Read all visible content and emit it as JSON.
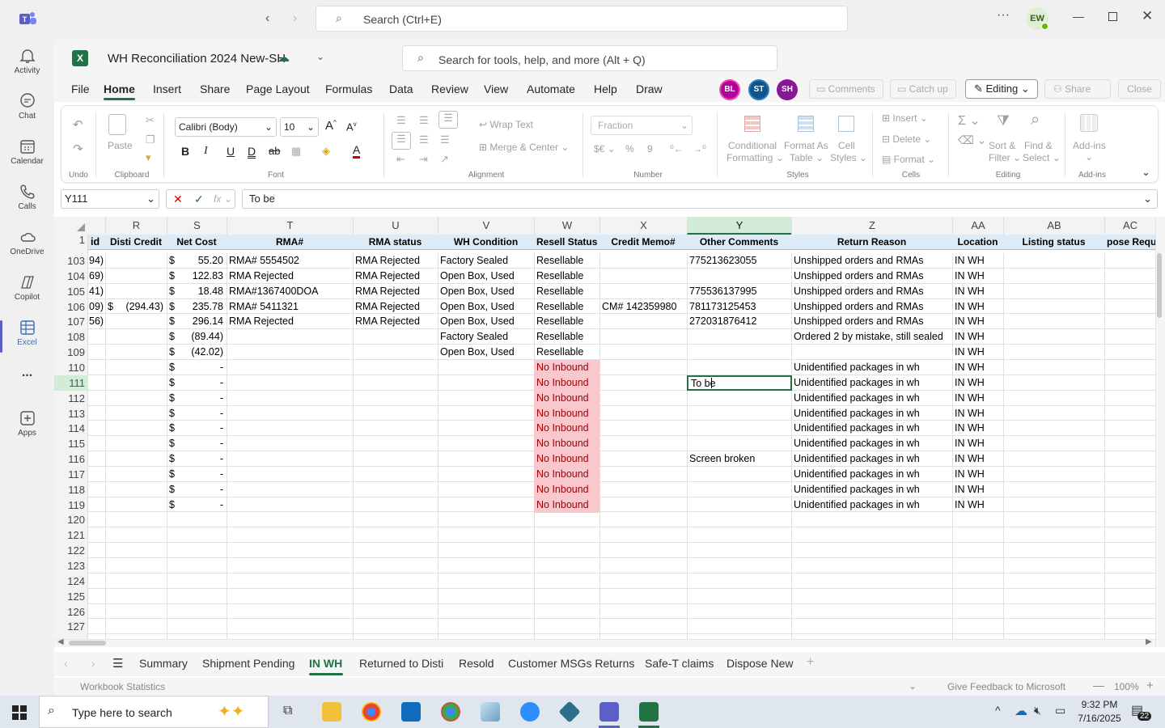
{
  "teams": {
    "search_placeholder": "Search (Ctrl+E)",
    "user_initials": "EW"
  },
  "rail": [
    {
      "label": "Activity",
      "icon": "bell-icon"
    },
    {
      "label": "Chat",
      "icon": "chat-icon"
    },
    {
      "label": "Calendar",
      "icon": "calendar-icon"
    },
    {
      "label": "Calls",
      "icon": "phone-icon"
    },
    {
      "label": "OneDrive",
      "icon": "cloud-icon"
    },
    {
      "label": "Copilot",
      "icon": "copilot-icon"
    },
    {
      "label": "Excel",
      "icon": "excel-icon"
    },
    {
      "label": "...",
      "icon": "more-icon"
    },
    {
      "label": "Apps",
      "icon": "apps-icon"
    }
  ],
  "workbook": {
    "title": "WH Reconciliation 2024 New-SH",
    "tools_search": "Search for tools, help, and more (Alt + Q)"
  },
  "menu": [
    "File",
    "Home",
    "Insert",
    "Share",
    "Page Layout",
    "Formulas",
    "Data",
    "Review",
    "View",
    "Automate",
    "Help",
    "Draw"
  ],
  "collab": {
    "avatars": [
      {
        "initials": "BL",
        "color": "#b4009e"
      },
      {
        "initials": "ST",
        "color": "#0f548c"
      },
      {
        "initials": "SH",
        "color": "#881798"
      }
    ],
    "comments": "Comments",
    "catchup": "Catch up",
    "editing": "Editing",
    "share": "Share",
    "close": "Close"
  },
  "ribbon": {
    "undo": "Undo",
    "paste": "Paste",
    "clipboard": "Clipboard",
    "font_name": "Calibri (Body)",
    "font_size": "10",
    "font": "Font",
    "wrap_text": "Wrap Text",
    "merge_center": "Merge & Center",
    "alignment": "Alignment",
    "number_format": "Fraction",
    "number": "Number",
    "conditional": "Conditional",
    "formatting": "Formatting",
    "format_as": "Format As",
    "table": "Table",
    "cell": "Cell",
    "styles_btn": "Styles",
    "styles": "Styles",
    "insert": "Insert",
    "delete": "Delete",
    "format": "Format",
    "cells": "Cells",
    "sort": "Sort &",
    "filter": "Filter",
    "find": "Find &",
    "select": "Select",
    "editing": "Editing",
    "addins": "Add-ins",
    "addins_label": "Add-ins"
  },
  "formula": {
    "namebox": "Y111",
    "value": "To be"
  },
  "columns": [
    {
      "letter": "R",
      "header": "Disti Credit"
    },
    {
      "letter": "S",
      "header": "Net Cost"
    },
    {
      "letter": "T",
      "header": "RMA#"
    },
    {
      "letter": "U",
      "header": "RMA status"
    },
    {
      "letter": "V",
      "header": "WH Condition"
    },
    {
      "letter": "W",
      "header": "Resell Status"
    },
    {
      "letter": "X",
      "header": "Credit Memo#"
    },
    {
      "letter": "Y",
      "header": "Other Comments"
    },
    {
      "letter": "Z",
      "header": "Return Reason"
    },
    {
      "letter": "AA",
      "header": "Location"
    },
    {
      "letter": "AB",
      "header": "Listing status"
    },
    {
      "letter": "AC",
      "header": "pose Requir"
    }
  ],
  "partial_col_header": "id",
  "header_row_num": "1",
  "rows": [
    {
      "n": "103",
      "q": "94)",
      "r": "",
      "s": "55.20",
      "t": "RMA# 5554502",
      "u": "RMA Rejected",
      "v": "Factory Sealed",
      "w": "Resellable",
      "x": "",
      "y": "775213623055",
      "z": "Unshipped orders and RMAs",
      "aa": "IN WH"
    },
    {
      "n": "104",
      "q": "69)",
      "r": "",
      "s": "122.83",
      "t": "RMA Rejected",
      "u": "RMA Rejected",
      "v": "Open Box, Used",
      "w": "Resellable",
      "x": "",
      "y": "",
      "z": "Unshipped orders and RMAs",
      "aa": "IN WH"
    },
    {
      "n": "105",
      "q": "41)",
      "r": "",
      "s": "18.48",
      "t": "RMA#1367400DOA",
      "u": "RMA Rejected",
      "v": "Open Box, Used",
      "w": "Resellable",
      "x": "",
      "y": "775536137995",
      "z": "Unshipped orders and RMAs",
      "aa": "IN WH"
    },
    {
      "n": "106",
      "q": "09)",
      "r": "(294.43)",
      "s": "235.78",
      "t": "RMA# 5411321",
      "u": "RMA Rejected",
      "v": "Open Box, Used",
      "w": "Resellable",
      "x": "CM# 142359980",
      "y": "781173125453",
      "z": "Unshipped orders and RMAs",
      "aa": "IN WH"
    },
    {
      "n": "107",
      "q": "56)",
      "r": "",
      "s": "296.14",
      "t": "RMA Rejected",
      "u": "RMA Rejected",
      "v": "Open Box, Used",
      "w": "Resellable",
      "x": "",
      "y": "272031876412",
      "z": "Unshipped orders and RMAs",
      "aa": "IN WH"
    },
    {
      "n": "108",
      "q": "",
      "r": "",
      "s": "(89.44)",
      "t": "",
      "u": "",
      "v": "Factory Sealed",
      "w": "Resellable",
      "x": "",
      "y": "",
      "z": "Ordered 2 by mistake, still sealed",
      "aa": "IN WH"
    },
    {
      "n": "109",
      "q": "",
      "r": "",
      "s": "(42.02)",
      "t": "",
      "u": "",
      "v": "Open Box, Used",
      "w": "Resellable",
      "x": "",
      "y": "",
      "z": "",
      "aa": "IN WH"
    },
    {
      "n": "110",
      "q": "",
      "r": "",
      "s": "-",
      "t": "",
      "u": "",
      "v": "",
      "w": "No Inbound",
      "x": "",
      "y": "",
      "z": "Unidentified packages in wh",
      "aa": "IN WH"
    },
    {
      "n": "111",
      "q": "",
      "r": "",
      "s": "-",
      "t": "",
      "u": "",
      "v": "",
      "w": "No Inbound",
      "x": "",
      "y": "To be",
      "z": "Unidentified packages in wh",
      "aa": "IN WH"
    },
    {
      "n": "112",
      "q": "",
      "r": "",
      "s": "-",
      "t": "",
      "u": "",
      "v": "",
      "w": "No Inbound",
      "x": "",
      "y": "",
      "z": "Unidentified packages in wh",
      "aa": "IN WH"
    },
    {
      "n": "113",
      "q": "",
      "r": "",
      "s": "-",
      "t": "",
      "u": "",
      "v": "",
      "w": "No Inbound",
      "x": "",
      "y": "",
      "z": "Unidentified packages in wh",
      "aa": "IN WH"
    },
    {
      "n": "114",
      "q": "",
      "r": "",
      "s": "-",
      "t": "",
      "u": "",
      "v": "",
      "w": "No Inbound",
      "x": "",
      "y": "",
      "z": "Unidentified packages in wh",
      "aa": "IN WH"
    },
    {
      "n": "115",
      "q": "",
      "r": "",
      "s": "-",
      "t": "",
      "u": "",
      "v": "",
      "w": "No Inbound",
      "x": "",
      "y": "",
      "z": "Unidentified packages in wh",
      "aa": "IN WH"
    },
    {
      "n": "116",
      "q": "",
      "r": "",
      "s": "-",
      "t": "",
      "u": "",
      "v": "",
      "w": "No Inbound",
      "x": "",
      "y": "Screen broken",
      "z": "Unidentified packages in wh",
      "aa": "IN WH"
    },
    {
      "n": "117",
      "q": "",
      "r": "",
      "s": "-",
      "t": "",
      "u": "",
      "v": "",
      "w": "No Inbound",
      "x": "",
      "y": "",
      "z": "Unidentified packages in wh",
      "aa": "IN WH"
    },
    {
      "n": "118",
      "q": "",
      "r": "",
      "s": "-",
      "t": "",
      "u": "",
      "v": "",
      "w": "No Inbound",
      "x": "",
      "y": "",
      "z": "Unidentified packages in wh",
      "aa": "IN WH"
    },
    {
      "n": "119",
      "q": "",
      "r": "",
      "s": "-",
      "t": "",
      "u": "",
      "v": "",
      "w": "No Inbound",
      "x": "",
      "y": "",
      "z": "Unidentified packages in wh",
      "aa": "IN WH"
    },
    {
      "n": "120"
    },
    {
      "n": "121"
    },
    {
      "n": "122"
    },
    {
      "n": "123"
    },
    {
      "n": "124"
    },
    {
      "n": "125"
    },
    {
      "n": "126"
    },
    {
      "n": "127"
    }
  ],
  "currency_symbol": "$",
  "sheets": [
    "Summary",
    "Shipment Pending",
    "IN WH",
    "Returned to Disti",
    "Resold",
    "Customer MSGs Returns",
    "Safe-T claims",
    "Dispose New"
  ],
  "active_sheet": "IN WH",
  "status": {
    "left": "Workbook Statistics",
    "feedback": "Give Feedback to Microsoft",
    "zoom": "100%"
  },
  "taskbar": {
    "search": "Type here to search",
    "time": "9:32 PM",
    "date": "7/16/2025",
    "notif": "22"
  },
  "colors": {
    "excel_green": "#217346",
    "no_inbound_bg": "#f8c8cc",
    "no_inbound_text": "#9c0006",
    "header_row_bg": "#ddebf7"
  }
}
